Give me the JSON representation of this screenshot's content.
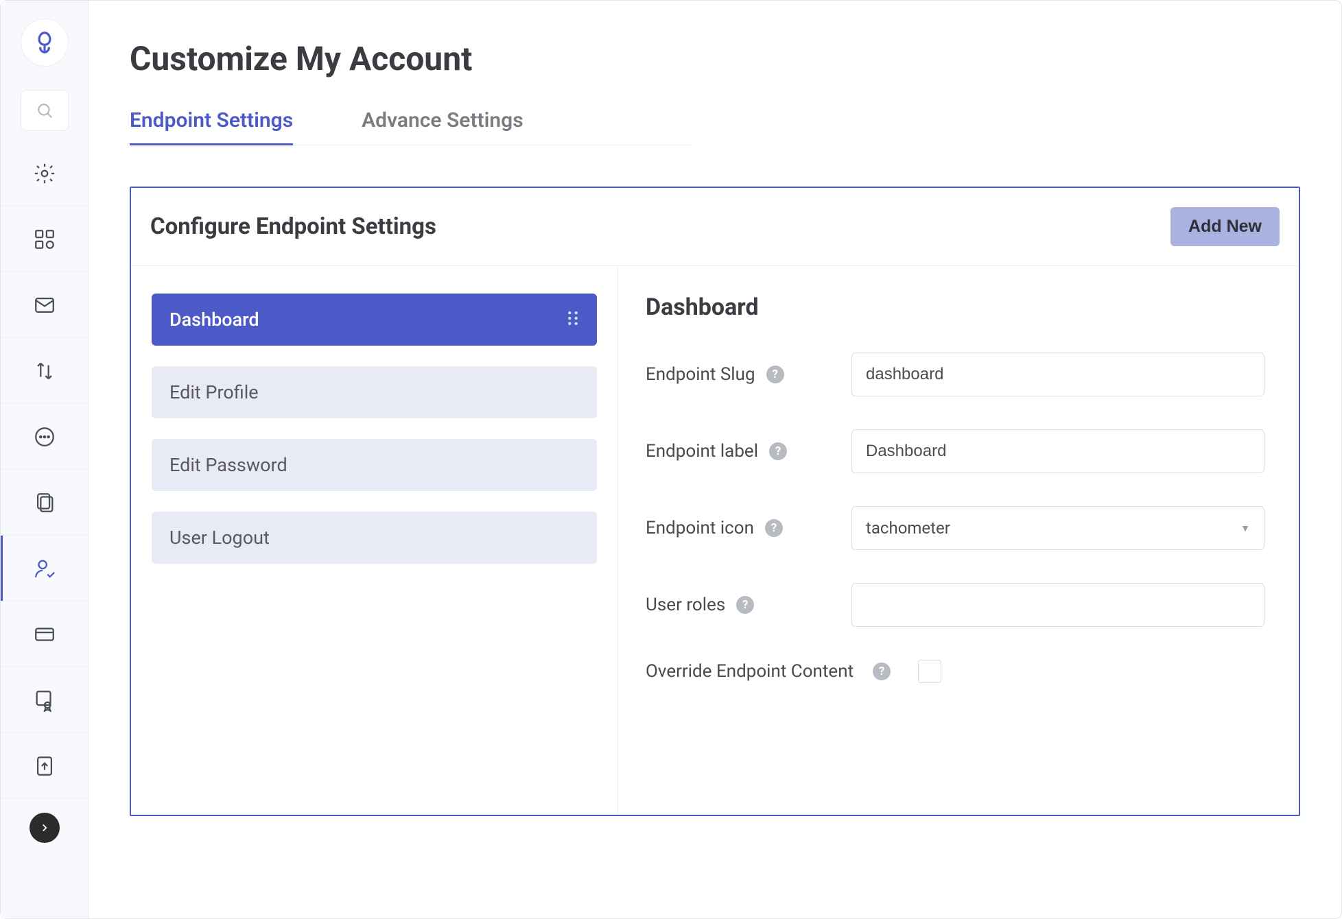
{
  "page": {
    "title": "Customize My Account"
  },
  "tabs": [
    {
      "label": "Endpoint Settings",
      "active": true
    },
    {
      "label": "Advance Settings",
      "active": false
    }
  ],
  "panel": {
    "title": "Configure Endpoint Settings",
    "add_label": "Add New"
  },
  "endpoints": [
    {
      "label": "Dashboard",
      "active": true
    },
    {
      "label": "Edit Profile",
      "active": false
    },
    {
      "label": "Edit Password",
      "active": false
    },
    {
      "label": "User Logout",
      "active": false
    }
  ],
  "form": {
    "title": "Dashboard",
    "slug": {
      "label": "Endpoint Slug",
      "value": "dashboard"
    },
    "labelField": {
      "label": "Endpoint label",
      "value": "Dashboard"
    },
    "icon": {
      "label": "Endpoint icon",
      "value": "tachometer"
    },
    "roles": {
      "label": "User roles",
      "value": ""
    },
    "override": {
      "label": "Override Endpoint Content",
      "checked": false
    }
  },
  "sidebar": {
    "icons": [
      "settings",
      "extensions",
      "mail",
      "sort",
      "more",
      "pages",
      "account",
      "card",
      "cert",
      "upload"
    ],
    "active_index": 6
  }
}
